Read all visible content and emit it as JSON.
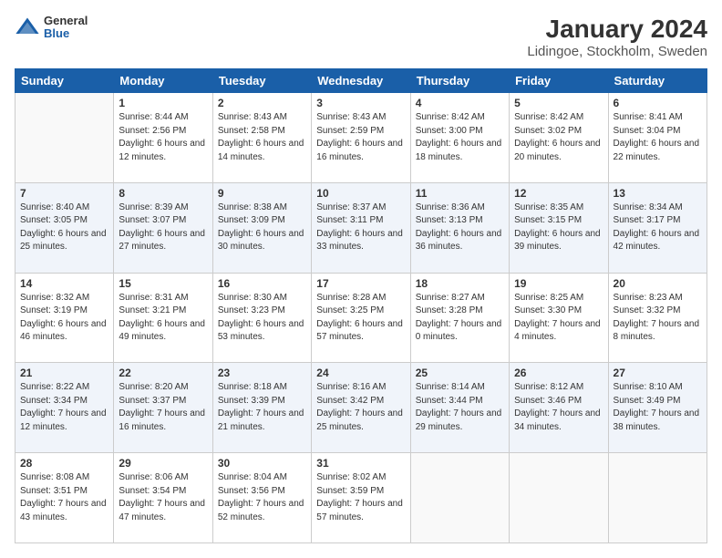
{
  "logo": {
    "general": "General",
    "blue": "Blue"
  },
  "title": "January 2024",
  "subtitle": "Lidingoe, Stockholm, Sweden",
  "days_of_week": [
    "Sunday",
    "Monday",
    "Tuesday",
    "Wednesday",
    "Thursday",
    "Friday",
    "Saturday"
  ],
  "weeks": [
    [
      {
        "day": "",
        "sunrise": "",
        "sunset": "",
        "daylight": ""
      },
      {
        "day": "1",
        "sunrise": "Sunrise: 8:44 AM",
        "sunset": "Sunset: 2:56 PM",
        "daylight": "Daylight: 6 hours and 12 minutes."
      },
      {
        "day": "2",
        "sunrise": "Sunrise: 8:43 AM",
        "sunset": "Sunset: 2:58 PM",
        "daylight": "Daylight: 6 hours and 14 minutes."
      },
      {
        "day": "3",
        "sunrise": "Sunrise: 8:43 AM",
        "sunset": "Sunset: 2:59 PM",
        "daylight": "Daylight: 6 hours and 16 minutes."
      },
      {
        "day": "4",
        "sunrise": "Sunrise: 8:42 AM",
        "sunset": "Sunset: 3:00 PM",
        "daylight": "Daylight: 6 hours and 18 minutes."
      },
      {
        "day": "5",
        "sunrise": "Sunrise: 8:42 AM",
        "sunset": "Sunset: 3:02 PM",
        "daylight": "Daylight: 6 hours and 20 minutes."
      },
      {
        "day": "6",
        "sunrise": "Sunrise: 8:41 AM",
        "sunset": "Sunset: 3:04 PM",
        "daylight": "Daylight: 6 hours and 22 minutes."
      }
    ],
    [
      {
        "day": "7",
        "sunrise": "Sunrise: 8:40 AM",
        "sunset": "Sunset: 3:05 PM",
        "daylight": "Daylight: 6 hours and 25 minutes."
      },
      {
        "day": "8",
        "sunrise": "Sunrise: 8:39 AM",
        "sunset": "Sunset: 3:07 PM",
        "daylight": "Daylight: 6 hours and 27 minutes."
      },
      {
        "day": "9",
        "sunrise": "Sunrise: 8:38 AM",
        "sunset": "Sunset: 3:09 PM",
        "daylight": "Daylight: 6 hours and 30 minutes."
      },
      {
        "day": "10",
        "sunrise": "Sunrise: 8:37 AM",
        "sunset": "Sunset: 3:11 PM",
        "daylight": "Daylight: 6 hours and 33 minutes."
      },
      {
        "day": "11",
        "sunrise": "Sunrise: 8:36 AM",
        "sunset": "Sunset: 3:13 PM",
        "daylight": "Daylight: 6 hours and 36 minutes."
      },
      {
        "day": "12",
        "sunrise": "Sunrise: 8:35 AM",
        "sunset": "Sunset: 3:15 PM",
        "daylight": "Daylight: 6 hours and 39 minutes."
      },
      {
        "day": "13",
        "sunrise": "Sunrise: 8:34 AM",
        "sunset": "Sunset: 3:17 PM",
        "daylight": "Daylight: 6 hours and 42 minutes."
      }
    ],
    [
      {
        "day": "14",
        "sunrise": "Sunrise: 8:32 AM",
        "sunset": "Sunset: 3:19 PM",
        "daylight": "Daylight: 6 hours and 46 minutes."
      },
      {
        "day": "15",
        "sunrise": "Sunrise: 8:31 AM",
        "sunset": "Sunset: 3:21 PM",
        "daylight": "Daylight: 6 hours and 49 minutes."
      },
      {
        "day": "16",
        "sunrise": "Sunrise: 8:30 AM",
        "sunset": "Sunset: 3:23 PM",
        "daylight": "Daylight: 6 hours and 53 minutes."
      },
      {
        "day": "17",
        "sunrise": "Sunrise: 8:28 AM",
        "sunset": "Sunset: 3:25 PM",
        "daylight": "Daylight: 6 hours and 57 minutes."
      },
      {
        "day": "18",
        "sunrise": "Sunrise: 8:27 AM",
        "sunset": "Sunset: 3:28 PM",
        "daylight": "Daylight: 7 hours and 0 minutes."
      },
      {
        "day": "19",
        "sunrise": "Sunrise: 8:25 AM",
        "sunset": "Sunset: 3:30 PM",
        "daylight": "Daylight: 7 hours and 4 minutes."
      },
      {
        "day": "20",
        "sunrise": "Sunrise: 8:23 AM",
        "sunset": "Sunset: 3:32 PM",
        "daylight": "Daylight: 7 hours and 8 minutes."
      }
    ],
    [
      {
        "day": "21",
        "sunrise": "Sunrise: 8:22 AM",
        "sunset": "Sunset: 3:34 PM",
        "daylight": "Daylight: 7 hours and 12 minutes."
      },
      {
        "day": "22",
        "sunrise": "Sunrise: 8:20 AM",
        "sunset": "Sunset: 3:37 PM",
        "daylight": "Daylight: 7 hours and 16 minutes."
      },
      {
        "day": "23",
        "sunrise": "Sunrise: 8:18 AM",
        "sunset": "Sunset: 3:39 PM",
        "daylight": "Daylight: 7 hours and 21 minutes."
      },
      {
        "day": "24",
        "sunrise": "Sunrise: 8:16 AM",
        "sunset": "Sunset: 3:42 PM",
        "daylight": "Daylight: 7 hours and 25 minutes."
      },
      {
        "day": "25",
        "sunrise": "Sunrise: 8:14 AM",
        "sunset": "Sunset: 3:44 PM",
        "daylight": "Daylight: 7 hours and 29 minutes."
      },
      {
        "day": "26",
        "sunrise": "Sunrise: 8:12 AM",
        "sunset": "Sunset: 3:46 PM",
        "daylight": "Daylight: 7 hours and 34 minutes."
      },
      {
        "day": "27",
        "sunrise": "Sunrise: 8:10 AM",
        "sunset": "Sunset: 3:49 PM",
        "daylight": "Daylight: 7 hours and 38 minutes."
      }
    ],
    [
      {
        "day": "28",
        "sunrise": "Sunrise: 8:08 AM",
        "sunset": "Sunset: 3:51 PM",
        "daylight": "Daylight: 7 hours and 43 minutes."
      },
      {
        "day": "29",
        "sunrise": "Sunrise: 8:06 AM",
        "sunset": "Sunset: 3:54 PM",
        "daylight": "Daylight: 7 hours and 47 minutes."
      },
      {
        "day": "30",
        "sunrise": "Sunrise: 8:04 AM",
        "sunset": "Sunset: 3:56 PM",
        "daylight": "Daylight: 7 hours and 52 minutes."
      },
      {
        "day": "31",
        "sunrise": "Sunrise: 8:02 AM",
        "sunset": "Sunset: 3:59 PM",
        "daylight": "Daylight: 7 hours and 57 minutes."
      },
      {
        "day": "",
        "sunrise": "",
        "sunset": "",
        "daylight": ""
      },
      {
        "day": "",
        "sunrise": "",
        "sunset": "",
        "daylight": ""
      },
      {
        "day": "",
        "sunrise": "",
        "sunset": "",
        "daylight": ""
      }
    ]
  ]
}
